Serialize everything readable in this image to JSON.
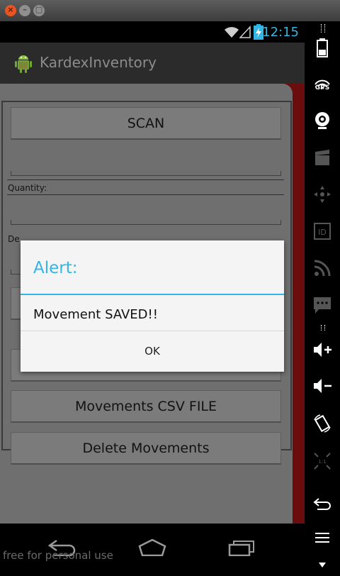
{
  "status": {
    "time": "12:15"
  },
  "app": {
    "title": "KardexInventory"
  },
  "form": {
    "scan_label": "SCAN",
    "quantity_label": "Quantity:",
    "description_label_partial": "De",
    "csv_button_label": "Movements CSV FILE",
    "delete_button_label": "Delete Movements"
  },
  "dialog": {
    "title": "Alert:",
    "message": "Movement SAVED!!",
    "ok_label": "OK"
  },
  "side_controls": {
    "gps_label": "GPS"
  },
  "watermark": "free for personal use",
  "colors": {
    "accent": "#33b5e5",
    "background_dim": "#6f6f6f",
    "underlay": "#6b0d0d"
  }
}
